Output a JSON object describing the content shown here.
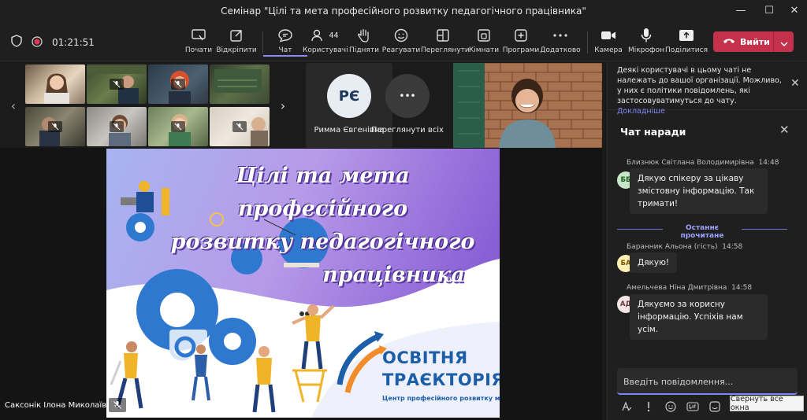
{
  "window": {
    "title": "Семінар \"Цілі та мета професійного розвитку педагогічного працівника\"",
    "minimize_glyph": "—",
    "maximize_glyph": "☐",
    "close_glyph": "✕"
  },
  "toolbar": {
    "timer": "01:21:51",
    "start": "Почати",
    "open": "Відкріпити",
    "chat": "Чат",
    "participants": "Користувачі",
    "participants_count": "44",
    "raise": "Підняти",
    "react": "Реагувати",
    "view": "Переглянути",
    "rooms": "Кімнати",
    "apps": "Програми",
    "more": "Додатково",
    "camera": "Камера",
    "mic": "Мікрофон",
    "share": "Поділитися",
    "leave": "Вийти"
  },
  "strip": {
    "tile1_initials": "РЄ",
    "tile1_name": "Римма Євгенівна",
    "tile2_glyph": "•••",
    "tile2_name": "Переглянути всіх",
    "prev_glyph": "‹",
    "next_glyph": "›"
  },
  "slide": {
    "title_line1": "Цілі та мета професійного",
    "title_line2": "розвитку педагогічного",
    "title_line3": "працівника",
    "brand_line1": "ОСВІТНЯ",
    "brand_line2": "ТРАЄКТОРІЯ",
    "brand_sub": "Центр професійного розвитку м. Дніпро"
  },
  "presenter": {
    "name": "Саксонік Ілона Миколаївна"
  },
  "banner": {
    "text": "Деякі користувачі в цьому чаті не належать до вашої організації. Можливо, у них є політики повідомлень, які застосовуватимуться до чату.",
    "link": "Докладніше",
    "close_glyph": "✕"
  },
  "chat": {
    "title": "Чат наради",
    "close_glyph": "✕",
    "last_read": "Останнє прочитане",
    "messages": [
      {
        "author": "Близнюк Світлана Володимирівна",
        "time": "14:48",
        "initials": "ББ",
        "text": "Дякую спікеру за цікаву змістовну інформацію. Так тримати!"
      },
      {
        "author": "Баранник Альона (гість)",
        "time": "14:58",
        "initials": "БА",
        "text": "Дякую!"
      },
      {
        "author": "Амельчева Ніна Дмитрівна",
        "time": "14:58",
        "initials": "АД",
        "text": "Дякуємо за корисну інформацію. Успіхів нам усім."
      }
    ],
    "compose_placeholder": "Введіть повідомлення..."
  },
  "tooltip": "Свернуть все окна",
  "colors": {
    "accent": "#7f85f5",
    "leave": "#c4314b",
    "avatar1": "#c8e6c9",
    "avatar2": "#fff0b3",
    "avatar3": "#f3e5e5"
  },
  "icons": [
    "shield-icon",
    "record-icon",
    "start-icon",
    "popout-icon",
    "chat-icon",
    "people-icon",
    "raise-hand-icon",
    "emoji-icon",
    "view-icon",
    "rooms-icon",
    "apps-icon",
    "more-icon",
    "camera-icon",
    "mic-icon",
    "share-icon",
    "phone-icon",
    "chevron-down-icon",
    "mic-off-icon"
  ]
}
